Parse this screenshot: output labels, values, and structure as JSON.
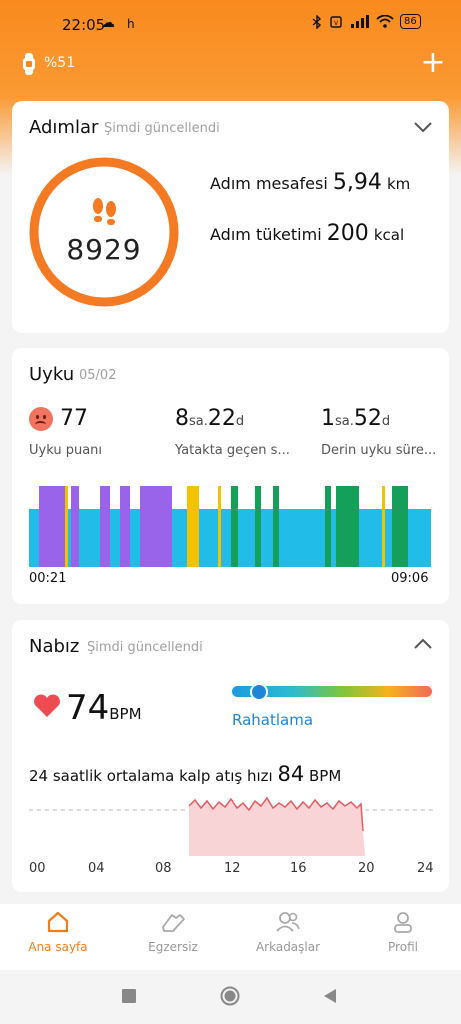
{
  "status_bar": {
    "time": "22:05",
    "notif_glyph": "h",
    "battery": "86",
    "icons": [
      "cloud-icon",
      "bluetooth-icon",
      "vibrate-icon",
      "signal-icon",
      "wifi-icon",
      "battery-icon"
    ]
  },
  "header": {
    "band_battery": "%51",
    "add_icon": "plus-icon"
  },
  "steps": {
    "title": "Adımlar",
    "subtitle": "Şimdi güncellendi",
    "count": "8929",
    "distance_label": "Adım mesafesi",
    "distance_value": "5,94",
    "distance_unit": "km",
    "calories_label": "Adım tüketimi",
    "calories_value": "200",
    "calories_unit": "kcal",
    "expand_icon": "chevron-down-icon"
  },
  "sleep": {
    "title": "Uyku",
    "date": "05/02",
    "score": "77",
    "score_label": "Uyku puanı",
    "bed_hours": "8",
    "bed_minutes": "22",
    "hour_unit": "sa.",
    "minute_unit": "d",
    "bed_label": "Yatakta geçen s...",
    "deep_hours": "1",
    "deep_minutes": "52",
    "deep_label": "Derin uyku süre...",
    "start_time": "00:21",
    "end_time": "09:06",
    "colors": {
      "light": "#21bde8",
      "rem": "#9a64ea",
      "deep": "#14a05a",
      "awake": "#f3c200"
    }
  },
  "heart": {
    "title": "Nabız",
    "subtitle": "Şimdi güncellendi",
    "value": "74",
    "unit": "BPM",
    "zone": "Rahatlama",
    "zone_level": 0.14,
    "avg_label": "24 saatlik ortalama kalp atış hızı",
    "avg_value": "84",
    "avg_unit": "BPM",
    "axis": [
      "00",
      "04",
      "08",
      "12",
      "16",
      "20",
      "24"
    ],
    "collapse_icon": "chevron-up-icon"
  },
  "bottom_nav": {
    "items": [
      {
        "label": "Ana sayfa",
        "icon": "home-icon",
        "active": true
      },
      {
        "label": "Egzersiz",
        "icon": "shoe-icon",
        "active": false
      },
      {
        "label": "Arkadaşlar",
        "icon": "friends-icon",
        "active": false
      },
      {
        "label": "Profil",
        "icon": "profile-icon",
        "active": false
      }
    ],
    "active_color": "#f07d1a"
  },
  "system_nav": {
    "icons": [
      "recents-icon",
      "home-circle-icon",
      "back-icon"
    ]
  }
}
